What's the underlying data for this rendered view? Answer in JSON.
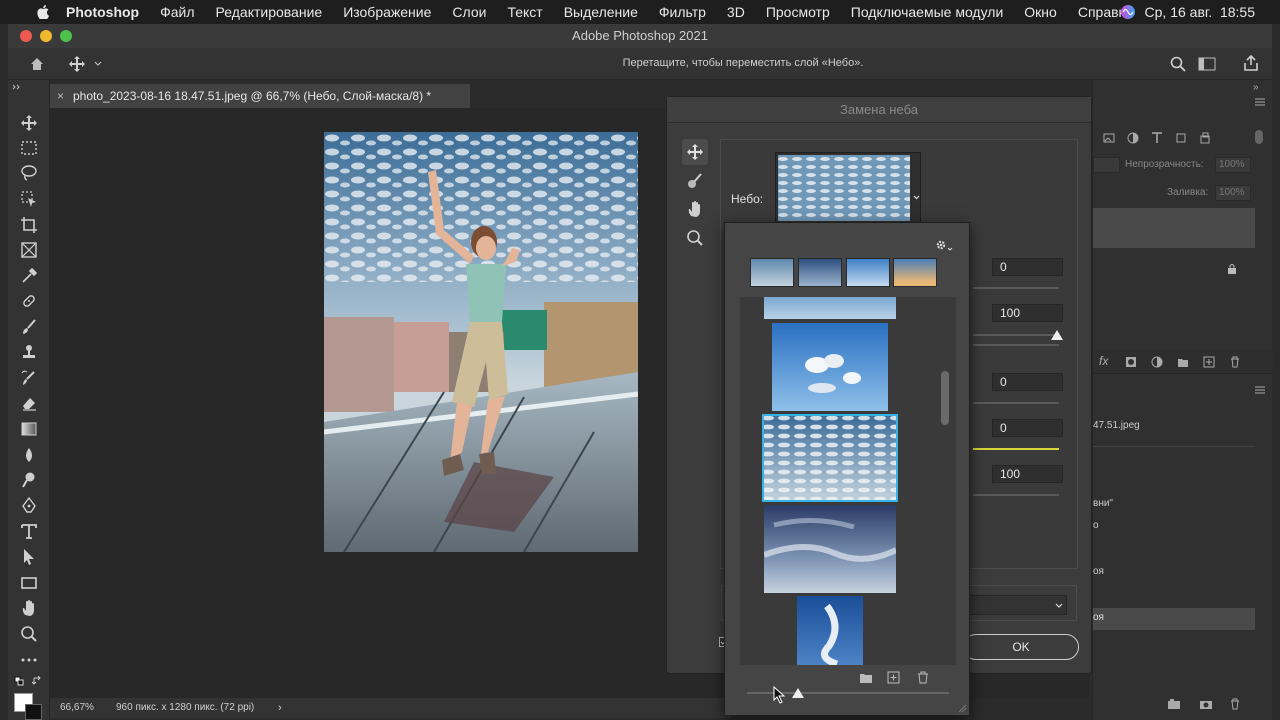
{
  "menubar": {
    "app": "Photoshop",
    "items": [
      "Файл",
      "Редактирование",
      "Изображение",
      "Слои",
      "Текст",
      "Выделение",
      "Фильтр",
      "3D",
      "Просмотр",
      "Подключаемые модули",
      "Окно",
      "Справка"
    ],
    "clock": "Ср, 16 авг.  18:55"
  },
  "window": {
    "title": "Adobe Photoshop 2021"
  },
  "options": {
    "hint": "Перетащите, чтобы переместить слой «Небо»."
  },
  "document": {
    "tab_title": "photo_2023-08-16 18.47.51.jpeg @ 66,7% (Небо, Слой-маска/8) *",
    "zoom": "66,67%",
    "dimensions": "960 пикс. x 1280 пикс. (72 ppi)"
  },
  "dialog": {
    "title": "Замена неба",
    "sky_label": "Небо:",
    "values": [
      "0",
      "100",
      "0",
      "0",
      "100"
    ],
    "ok_label": "OK"
  },
  "layers": {
    "opacity_label": "Непрозрачность:",
    "opacity_value": "100%",
    "fill_label": "Заливка:",
    "fill_value": "100%",
    "partial_texts": [
      "47.51.jpeg",
      "вни\"",
      "о",
      "оя",
      "оя"
    ]
  },
  "colors": {
    "bg_dark": "#282828",
    "panel": "#333333",
    "dialog": "#3c3c3c",
    "highlight_border": "#36b3e6",
    "slider_yellow": "#d7d63a"
  }
}
